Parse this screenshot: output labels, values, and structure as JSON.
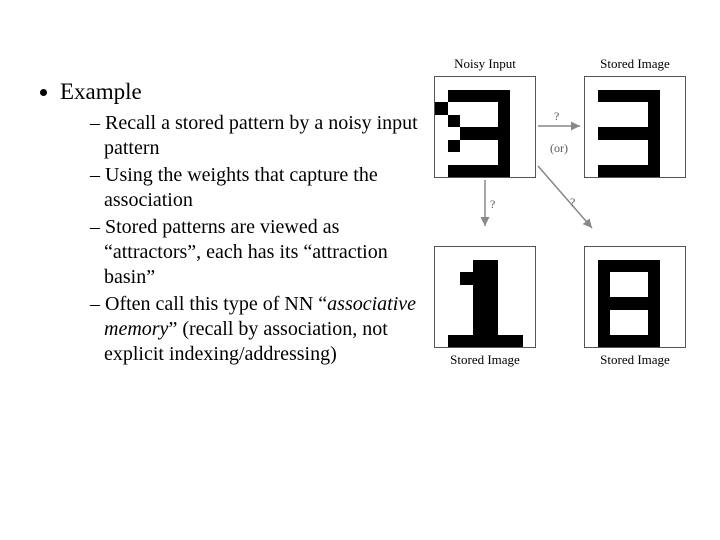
{
  "bullet_title": "Example",
  "subitems": [
    "Recall a stored pattern by a noisy input pattern",
    "Using the weights that capture the association",
    "Stored patterns are viewed as “attractors”, each has its “attraction basin”",
    "Often call this type of NN “associative memory” (recall by association, not explicit indexing/addressing)"
  ],
  "subitem4_emphasis": "associative memory",
  "figure": {
    "labels": {
      "noisy_input": "Noisy Input",
      "stored_image": "Stored Image",
      "or_text": "(or)"
    },
    "arrow_label": "?",
    "tiles": {
      "comment": "8x8 bitmaps, 1 = black pixel, 0 = white. Top-left is a noisy '3', top-right a clean '3', bottom-left a '1', bottom-right an '8'.",
      "noisy3": [
        [
          0,
          0,
          0,
          0,
          0,
          0,
          0,
          0
        ],
        [
          0,
          1,
          1,
          1,
          1,
          1,
          0,
          0
        ],
        [
          1,
          0,
          0,
          0,
          0,
          1,
          0,
          0
        ],
        [
          0,
          1,
          0,
          0,
          0,
          1,
          0,
          0
        ],
        [
          0,
          0,
          1,
          1,
          1,
          1,
          0,
          0
        ],
        [
          0,
          1,
          0,
          0,
          0,
          1,
          0,
          0
        ],
        [
          0,
          0,
          0,
          0,
          0,
          1,
          0,
          0
        ],
        [
          0,
          1,
          1,
          1,
          1,
          1,
          0,
          0
        ]
      ],
      "clean3": [
        [
          0,
          0,
          0,
          0,
          0,
          0,
          0,
          0
        ],
        [
          0,
          1,
          1,
          1,
          1,
          1,
          0,
          0
        ],
        [
          0,
          0,
          0,
          0,
          0,
          1,
          0,
          0
        ],
        [
          0,
          0,
          0,
          0,
          0,
          1,
          0,
          0
        ],
        [
          0,
          1,
          1,
          1,
          1,
          1,
          0,
          0
        ],
        [
          0,
          0,
          0,
          0,
          0,
          1,
          0,
          0
        ],
        [
          0,
          0,
          0,
          0,
          0,
          1,
          0,
          0
        ],
        [
          0,
          1,
          1,
          1,
          1,
          1,
          0,
          0
        ]
      ],
      "one": [
        [
          0,
          0,
          0,
          0,
          0,
          0,
          0,
          0
        ],
        [
          0,
          0,
          0,
          1,
          1,
          0,
          0,
          0
        ],
        [
          0,
          0,
          1,
          1,
          1,
          0,
          0,
          0
        ],
        [
          0,
          0,
          0,
          1,
          1,
          0,
          0,
          0
        ],
        [
          0,
          0,
          0,
          1,
          1,
          0,
          0,
          0
        ],
        [
          0,
          0,
          0,
          1,
          1,
          0,
          0,
          0
        ],
        [
          0,
          0,
          0,
          1,
          1,
          0,
          0,
          0
        ],
        [
          0,
          1,
          1,
          1,
          1,
          1,
          1,
          0
        ]
      ],
      "eight": [
        [
          0,
          0,
          0,
          0,
          0,
          0,
          0,
          0
        ],
        [
          0,
          1,
          1,
          1,
          1,
          1,
          0,
          0
        ],
        [
          0,
          1,
          0,
          0,
          0,
          1,
          0,
          0
        ],
        [
          0,
          1,
          0,
          0,
          0,
          1,
          0,
          0
        ],
        [
          0,
          1,
          1,
          1,
          1,
          1,
          0,
          0
        ],
        [
          0,
          1,
          0,
          0,
          0,
          1,
          0,
          0
        ],
        [
          0,
          1,
          0,
          0,
          0,
          1,
          0,
          0
        ],
        [
          0,
          1,
          1,
          1,
          1,
          1,
          0,
          0
        ]
      ]
    }
  }
}
